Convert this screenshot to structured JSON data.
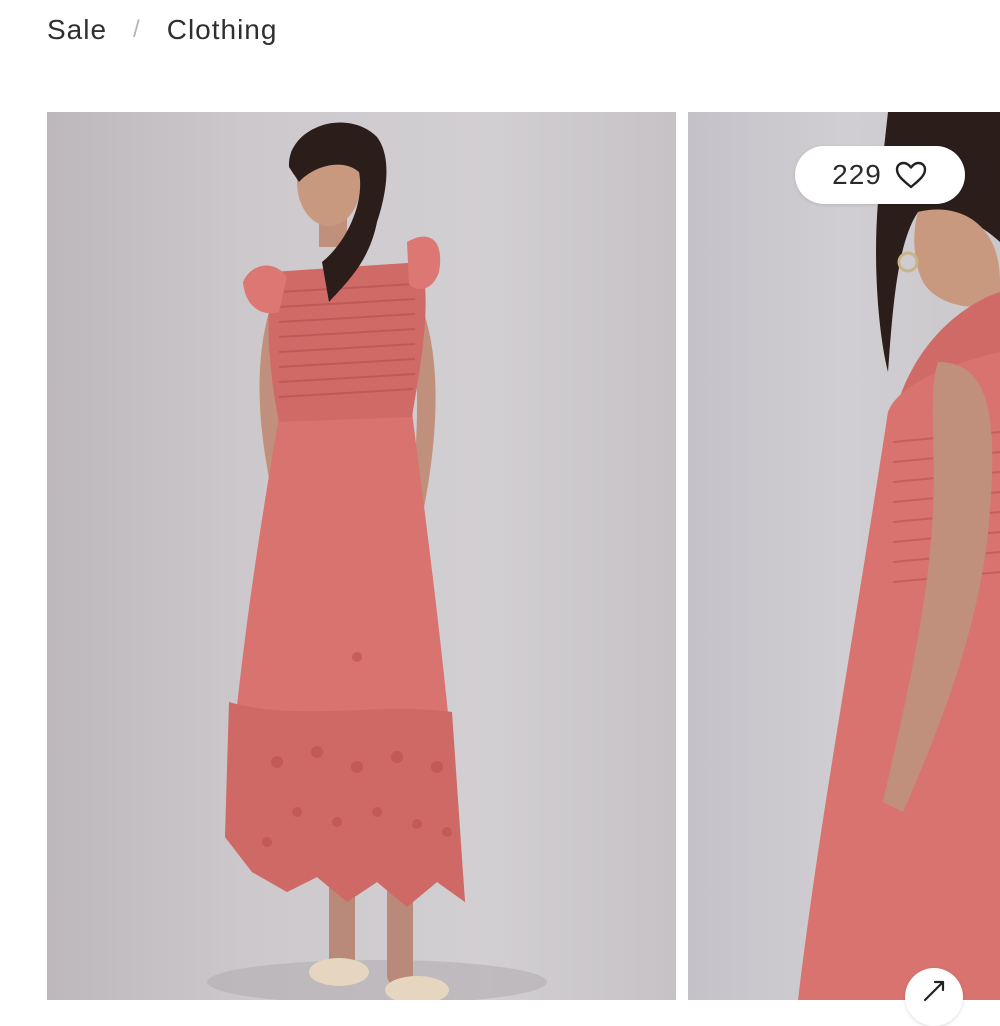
{
  "breadcrumb": {
    "items": [
      "Sale",
      "Clothing"
    ],
    "separator": "/"
  },
  "gallery": {
    "images": [
      {
        "alt_icon": "product-photo-full-length"
      },
      {
        "alt_icon": "product-photo-side-view"
      }
    ],
    "likes": {
      "count": "229",
      "icon": "heart-outline-icon"
    },
    "expand_icon": "expand-arrows-icon"
  },
  "colors": {
    "dress": "#d9736f",
    "backdrop": "#cdc9cd",
    "hair": "#2b1d19"
  }
}
